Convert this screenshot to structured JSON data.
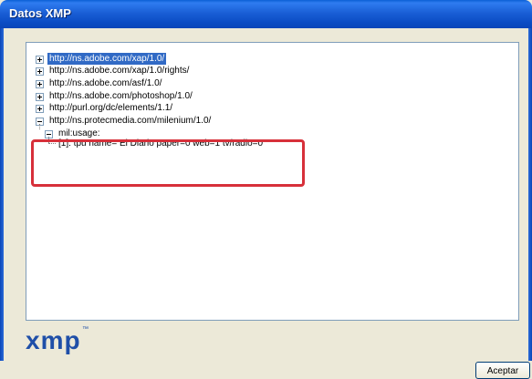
{
  "window": {
    "title": "Datos XMP"
  },
  "tree": {
    "nodes": [
      {
        "label": "http://ns.adobe.com/xap/1.0/",
        "expanded": false,
        "selected": true
      },
      {
        "label": "http://ns.adobe.com/xap/1.0/rights/",
        "expanded": false
      },
      {
        "label": "http://ns.adobe.com/asf/1.0/",
        "expanded": false
      },
      {
        "label": "http://ns.adobe.com/photoshop/1.0/",
        "expanded": false
      },
      {
        "label": "http://purl.org/dc/elements/1.1/",
        "expanded": false
      },
      {
        "label": "http://ns.protecmedia.com/milenium/1.0/",
        "expanded": true,
        "children": [
          {
            "label": "mil:usage:",
            "expanded": true,
            "children": [
              {
                "label": "[1]: tpu name= El Diario paper=0 web=1 tv/radio=0"
              }
            ]
          }
        ]
      }
    ]
  },
  "footer": {
    "logo_text": "xmp",
    "logo_mark": "™",
    "accept_label": "Aceptar"
  },
  "colors": {
    "titlebar": "#0b4cc4",
    "selection": "#316ac5",
    "highlight": "#d7303a",
    "logo": "#1f4fa8"
  }
}
